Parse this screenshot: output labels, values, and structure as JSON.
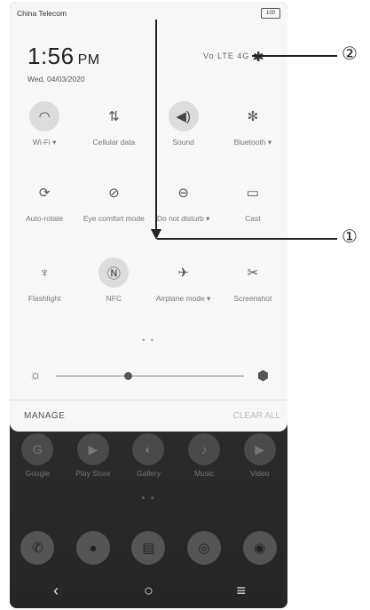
{
  "status_bar": {
    "carrier": "China Telecom",
    "battery": "100",
    "network_indicators": "Vo LTE 4G"
  },
  "clock": {
    "time": "1:56",
    "ampm": "PM",
    "date": "Wed, 04/03/2020"
  },
  "settings_icon": "gear-icon",
  "quick_tiles_row1": [
    {
      "label": "Wi-Fi ▾",
      "icon": "wifi-icon",
      "active": true
    },
    {
      "label": "Cellular data",
      "icon": "cellular-data-icon",
      "active": false
    },
    {
      "label": "Sound",
      "icon": "sound-icon",
      "active": true
    },
    {
      "label": "Bluetooth ▾",
      "icon": "bluetooth-icon",
      "active": false
    }
  ],
  "quick_tiles_row2": [
    {
      "label": "Auto-rotate",
      "icon": "auto-rotate-icon",
      "active": false
    },
    {
      "label": "Eye comfort mode",
      "icon": "eye-comfort-icon",
      "active": false
    },
    {
      "label": "Do not disturb ▾",
      "icon": "do-not-disturb-icon",
      "active": false
    },
    {
      "label": "Cast",
      "icon": "cast-icon",
      "active": false
    }
  ],
  "quick_tiles_row3": [
    {
      "label": "Flashlight",
      "icon": "flashlight-icon",
      "active": false
    },
    {
      "label": "NFC",
      "icon": "nfc-icon",
      "active": true
    },
    {
      "label": "Airplane mode ▾",
      "icon": "airplane-icon",
      "active": false
    },
    {
      "label": "Screenshot",
      "icon": "screenshot-icon",
      "active": false
    }
  ],
  "brightness": {
    "level_fraction": 0.38
  },
  "footer": {
    "manage": "MANAGE",
    "clear_all": "CLEAR ALL"
  },
  "home_apps": [
    {
      "label": "Google"
    },
    {
      "label": "Play Store"
    },
    {
      "label": "Gallery"
    },
    {
      "label": "Music"
    },
    {
      "label": "Video"
    }
  ],
  "callouts": {
    "one": "①",
    "two": "②"
  }
}
